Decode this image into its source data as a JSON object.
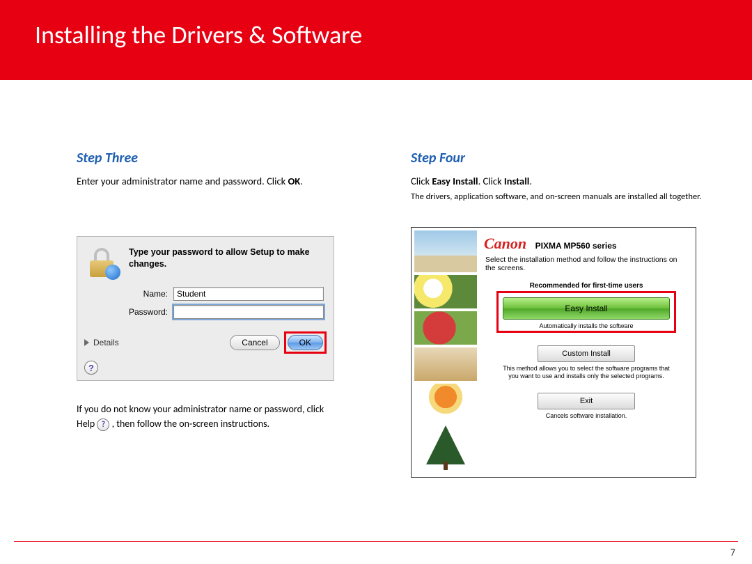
{
  "header": {
    "title": "Installing  the Drivers & Software"
  },
  "step3": {
    "heading": "Step Three",
    "instr_pre": "Enter your administrator name and password. Click ",
    "instr_b": "OK",
    "instr_post": ".",
    "dialog": {
      "message": "Type your password to allow Setup to make changes.",
      "name_label": "Name:",
      "name_value": "Student",
      "pw_label": "Password:",
      "details": "Details",
      "help": "?",
      "cancel": "Cancel",
      "ok": "OK"
    },
    "note1": "If you do not know your administrator name or password, click",
    "note2_pre": "Help ",
    "note2_post": " , then follow the on-screen instructions.",
    "help_icon": "?"
  },
  "step4": {
    "heading": "Step Four",
    "instr_pre": "Click ",
    "instr_b1": "Easy Install",
    "instr_mid": ". Click ",
    "instr_b2": "Install",
    "instr_post": ".",
    "sub": "The drivers, application software, and on-screen manuals are installed all together.",
    "panel": {
      "logo": "Canon",
      "product": "PIXMA MP560 series",
      "desc": "Select the installation method and follow the instructions on the screens.",
      "rec_label": "Recommended for first-time users",
      "easy": "Easy Install",
      "easy_sub": "Automatically installs the software",
      "custom": "Custom Install",
      "custom_sub": "This method allows you to select the software programs that you want to use and installs only the selected programs.",
      "exit": "Exit",
      "exit_sub": "Cancels software installation."
    }
  },
  "page_number": "7"
}
